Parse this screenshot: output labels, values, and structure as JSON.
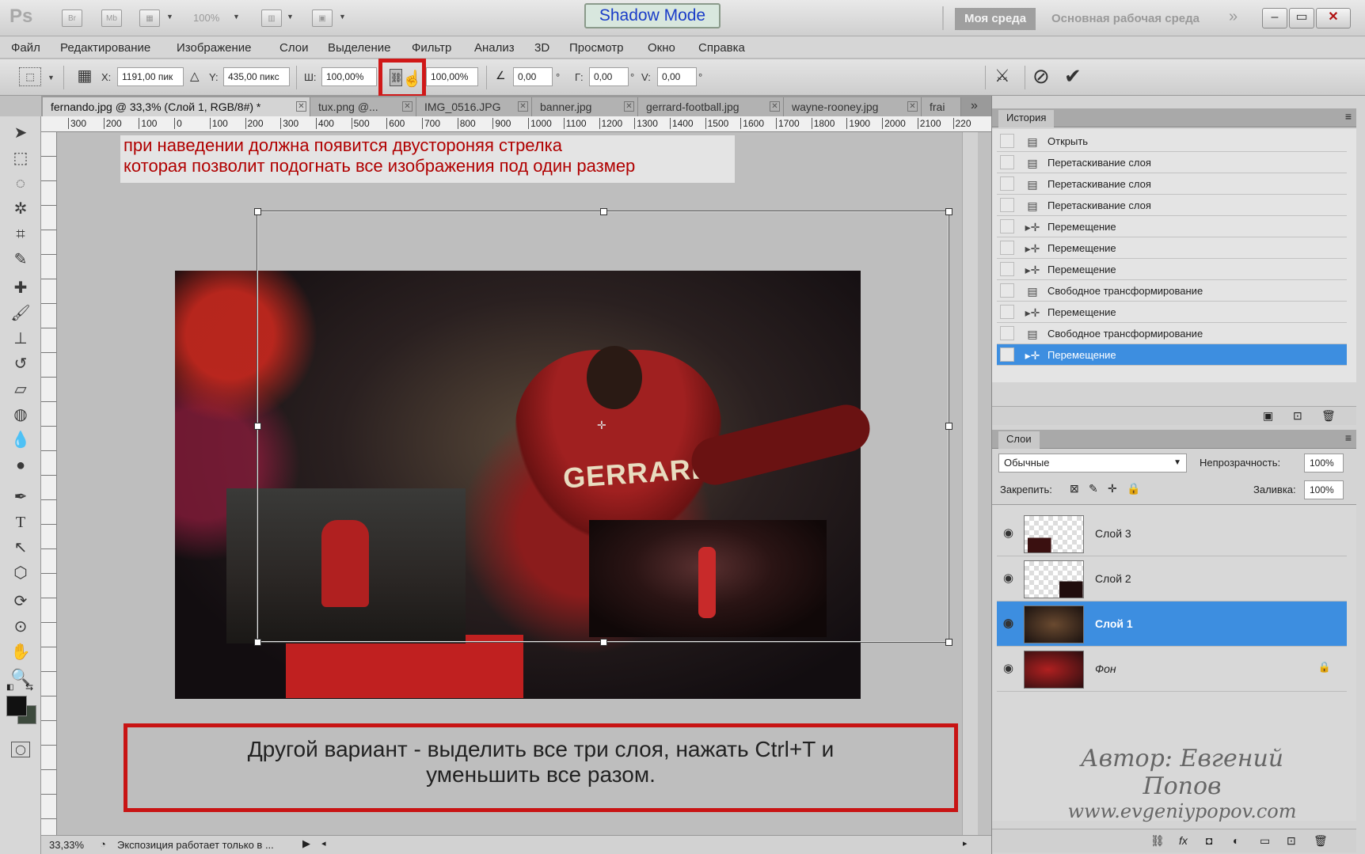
{
  "titlebar": {
    "app": "Ps",
    "zoom": "100%",
    "shadow_mode": "Shadow Mode",
    "workspace_mine": "Моя среда",
    "workspace_main": "Основная рабочая среда"
  },
  "menu": [
    "Файл",
    "Редактирование",
    "Изображение",
    "Слои",
    "Выделение",
    "Фильтр",
    "Анализ",
    "3D",
    "Просмотр",
    "Окно",
    "Справка"
  ],
  "options": {
    "x_label": "X:",
    "x_value": "1191,00 пик",
    "y_label": "Y:",
    "y_value": "435,00 пикс",
    "w_label": "Ш:",
    "w_value": "100,00%",
    "h_value": "100,00%",
    "angle_value": "0,00",
    "g_label": "Г:",
    "g_value": "0,00",
    "v_label": "V:",
    "v_value": "0,00"
  },
  "tabs": [
    "fernando.jpg @ 33,3% (Слой 1, RGB/8#) *",
    "tux.png @...",
    "IMG_0516.JPG",
    "banner.jpg",
    "gerrard-football.jpg",
    "wayne-rooney.jpg",
    "frai"
  ],
  "ruler_ticks": [
    "300",
    "200",
    "100",
    "0",
    "100",
    "200",
    "300",
    "400",
    "500",
    "600",
    "700",
    "800",
    "900",
    "1000",
    "1100",
    "1200",
    "1300",
    "1400",
    "1500",
    "1600",
    "1700",
    "1800",
    "1900",
    "2000",
    "2100",
    "220"
  ],
  "annotation": {
    "top_line1": "при наведении должна появится двустороняя стрелка",
    "top_line2": "которая позволит подогнать все изображения под один размер",
    "box_line1": "Другой вариант - выделить все три слоя, нажать Ctrl+T и",
    "box_line2": "уменьшить все разом.",
    "jersey_text": "GERRARD"
  },
  "watermark": {
    "line1": "Автор: Евгений Попов",
    "line2": "www.evgeniypopov.com"
  },
  "history": {
    "title": "История",
    "items": [
      {
        "label": "Открыть",
        "icon": "doc-icon"
      },
      {
        "label": "Перетаскивание слоя",
        "icon": "doc-icon"
      },
      {
        "label": "Перетаскивание слоя",
        "icon": "doc-icon"
      },
      {
        "label": "Перетаскивание слоя",
        "icon": "doc-icon"
      },
      {
        "label": "Перемещение",
        "icon": "move-icon"
      },
      {
        "label": "Перемещение",
        "icon": "move-icon"
      },
      {
        "label": "Перемещение",
        "icon": "move-icon"
      },
      {
        "label": "Свободное трансформирование",
        "icon": "doc-icon"
      },
      {
        "label": "Перемещение",
        "icon": "move-icon"
      },
      {
        "label": "Свободное трансформирование",
        "icon": "doc-icon"
      },
      {
        "label": "Перемещение",
        "icon": "move-icon",
        "selected": true
      }
    ]
  },
  "layers": {
    "title": "Слои",
    "blend_mode": "Обычные",
    "opacity_label": "Непрозрачность:",
    "opacity": "100%",
    "lock_label": "Закрепить:",
    "fill_label": "Заливка:",
    "fill": "100%",
    "items": [
      {
        "name": "Слой 3"
      },
      {
        "name": "Слой 2"
      },
      {
        "name": "Слой 1",
        "selected": true
      },
      {
        "name": "Фон",
        "locked": true
      }
    ]
  },
  "status": {
    "zoom": "33,33%",
    "info": "Экспозиция работает только в ..."
  },
  "colors": {
    "accent": "#3d8ee0",
    "highlight_red": "#d01818",
    "annotation_red": "#b00000"
  }
}
